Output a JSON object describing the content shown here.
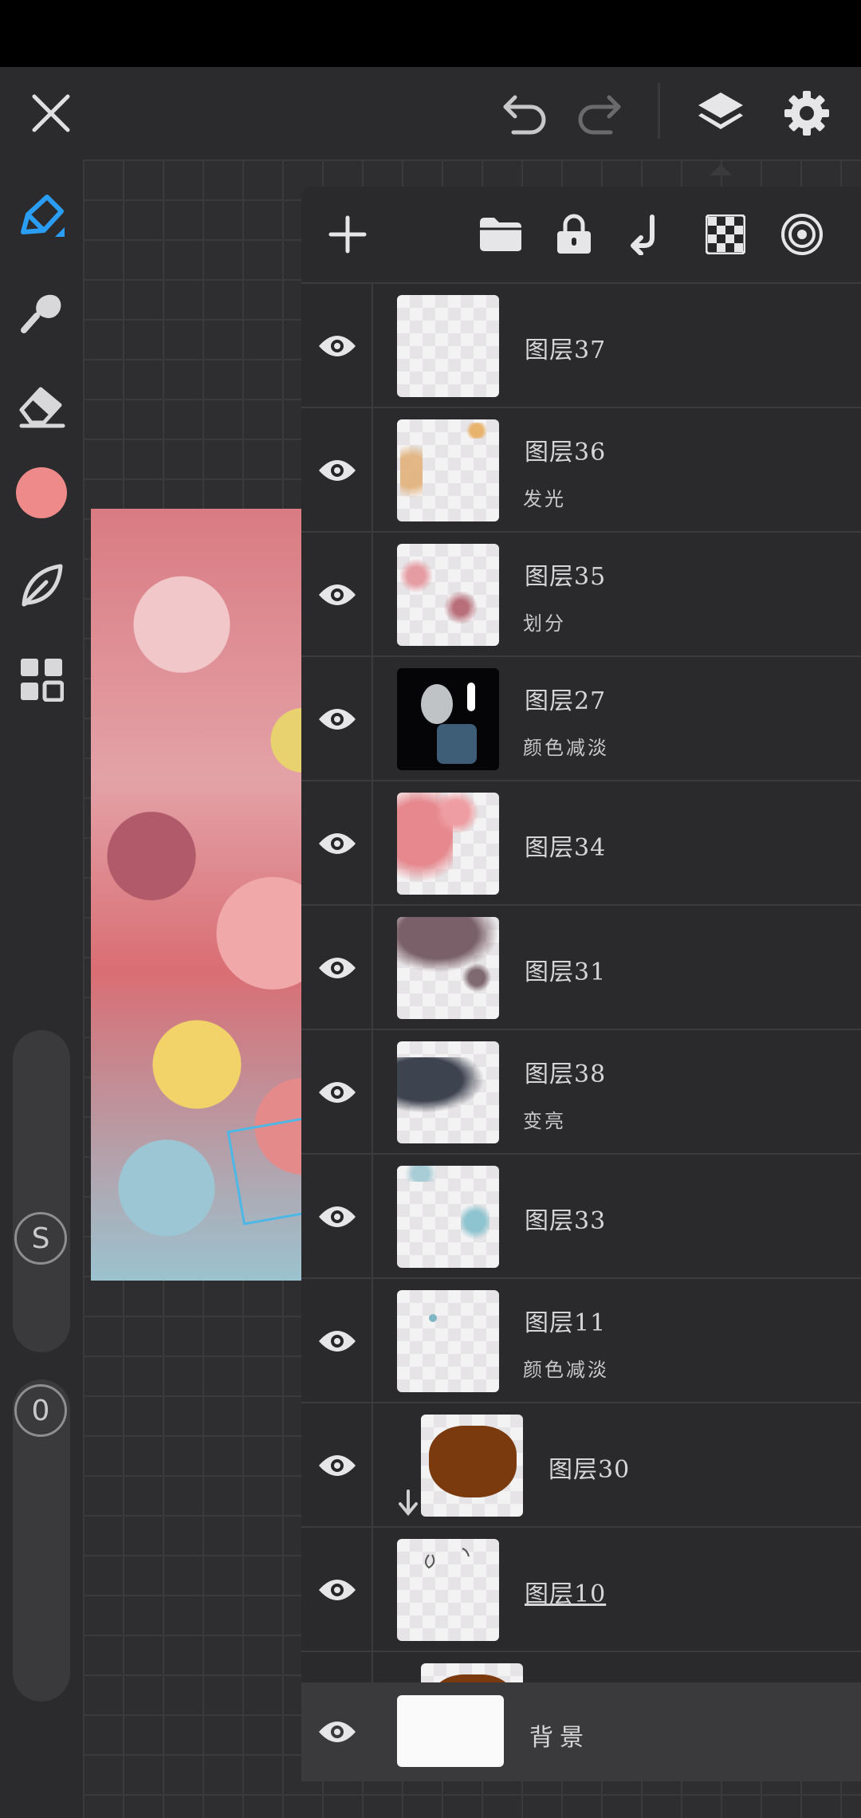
{
  "toolbar": {
    "close_icon": "close-icon",
    "undo_icon": "undo-icon",
    "redo_icon": "redo-icon",
    "layers_icon": "layers-icon",
    "settings_icon": "settings-icon"
  },
  "tools": {
    "brush": "pen-icon",
    "smudge": "smudge-icon",
    "eraser": "eraser-icon",
    "color": "#ee8a8a",
    "leaf": "leaf-icon",
    "grid": "grid-icon"
  },
  "sliders": {
    "size_badge": "S",
    "opacity_badge": "0"
  },
  "layers_panel": {
    "actions": [
      "add-icon",
      "folder-icon",
      "lock-icon",
      "clip-icon",
      "checkerboard-icon",
      "blend-icon"
    ],
    "layers": [
      {
        "name": "图层37",
        "mode": ""
      },
      {
        "name": "图层36",
        "mode": "发光"
      },
      {
        "name": "图层35",
        "mode": "划分"
      },
      {
        "name": "图层27",
        "mode": "颜色减淡"
      },
      {
        "name": "图层34",
        "mode": ""
      },
      {
        "name": "图层31",
        "mode": ""
      },
      {
        "name": "图层38",
        "mode": "变亮"
      },
      {
        "name": "图层33",
        "mode": ""
      },
      {
        "name": "图层11",
        "mode": "颜色减淡"
      },
      {
        "name": "图层30",
        "mode": ""
      },
      {
        "name": "图层10",
        "mode": ""
      }
    ],
    "background_label": "背景"
  }
}
